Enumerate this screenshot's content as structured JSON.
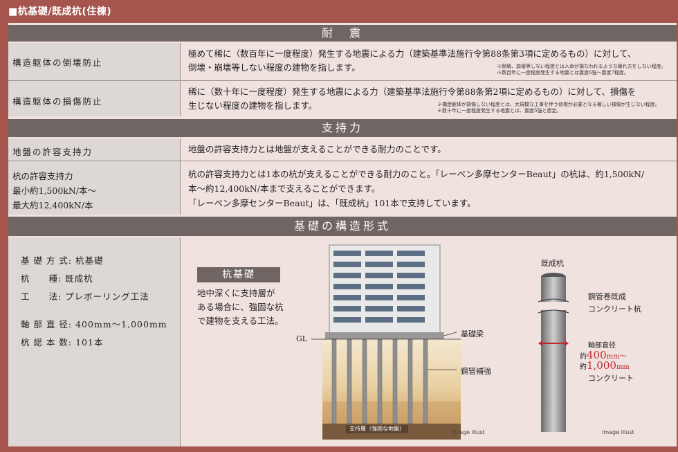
{
  "header": {
    "title": "■杭基礎/既成杭(住棟)"
  },
  "seismic": {
    "heading": "耐　震",
    "row1": {
      "label": "構造躯体の倒壊防止",
      "desc1": "極めて稀に（数百年に一度程度）発生する地震による力（建築基準法施行令第88条第3項に定めるもの）に対して、",
      "desc2": "倒壊・崩壊等しない程度の建物を指します。",
      "note1": "※倒壊、崩壊等しない程度とは人命が損なわれるような壊れ方をしない程度。",
      "note2": "※数百年に一度程度発生する地震とは震度6強〜震度7程度。"
    },
    "row2": {
      "label": "構造躯体の損傷防止",
      "desc1": "稀に（数十年に一度程度）発生する地震による力（建築基準法施行令第88条第2項に定めるもの）に対して、損傷を",
      "desc2": "生じない程度の建物を指します。",
      "note1": "※構造躯体が損傷しない程度とは、大規模な工事を伴う修復が必要となる著しい損傷が生じない程度。",
      "note2": "※数十年に一度程度発生する地震とは、震度5強と想定。"
    }
  },
  "bearing": {
    "heading": "支持力",
    "row1": {
      "label": "地盤の許容支持力",
      "desc": "地盤の許容支持力とは地盤が支えることができる耐力のことです。"
    },
    "row2": {
      "label1": "杭の許容支持力",
      "label2": "最小約1,500kN/本〜",
      "label3": "最大約12,400kN/本",
      "desc1": "杭の許容支持力とは1本の杭が支えることができる耐力のこと。「レーベン多摩センターBeaut」の杭は、約1,500kN/",
      "desc2": "本〜約12,400kN/本まで支えることができます。",
      "desc3": "「レーベン多摩センターBeaut」は、「既成杭」101本で支持しています。"
    }
  },
  "foundation": {
    "heading": "基礎の構造形式",
    "specs": [
      "基 礎 方 式: 杭基礎",
      "杭　　種: 既成杭",
      "工　　法: プレボーリング工法",
      "軸 部 直 径: 400mm〜1,000mm",
      "杭 総 本 数: 101本"
    ],
    "box_title": "杭基礎",
    "box_text": [
      "地中深くに支持層が",
      "ある場合に、強固な杭",
      "で建物を支える工法。"
    ],
    "diagram": {
      "gl": "GL",
      "beam": "基礎梁",
      "reinforce": "鋼管補強",
      "layer": "支持層（強固な地盤）",
      "illust": "Image illust"
    },
    "pile": {
      "title": "既成杭",
      "label1": "鋼管巻既成",
      "label2": "コンクリート杭",
      "axis": "軸部直径",
      "min_prefix": "約",
      "min": "400",
      "unit": "mm〜",
      "max_prefix": "約",
      "max": "1,000",
      "unit2": "mm",
      "concrete": "コンクリート",
      "illust": "Image illust"
    }
  },
  "colors": {
    "background": "#a5554e",
    "panel": "#f0e2df",
    "section_bar": "#6f6562",
    "accent_red": "#c0272d"
  }
}
